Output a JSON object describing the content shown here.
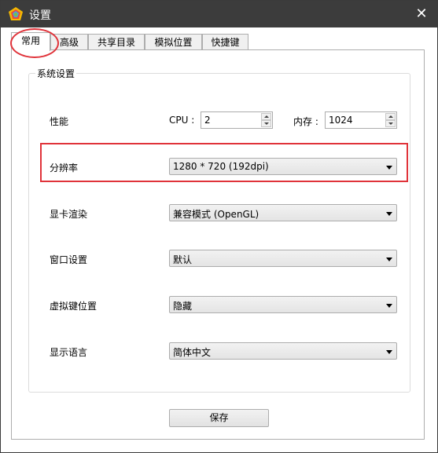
{
  "window": {
    "title": "设置",
    "close_icon": "✕"
  },
  "tabs": [
    {
      "label": "常用",
      "active": true
    },
    {
      "label": "高级",
      "active": false
    },
    {
      "label": "共享目录",
      "active": false
    },
    {
      "label": "模拟位置",
      "active": false
    },
    {
      "label": "快捷键",
      "active": false
    }
  ],
  "group": {
    "label": "系统设置"
  },
  "performance": {
    "label": "性能",
    "cpu_label": "CPU :",
    "cpu_value": "2",
    "memory_label": "内存 :",
    "memory_value": "1024"
  },
  "resolution": {
    "label": "分辨率",
    "value": "1280 * 720 (192dpi)"
  },
  "gpu_render": {
    "label": "显卡渲染",
    "value": "兼容模式 (OpenGL)"
  },
  "window_setting": {
    "label": "窗口设置",
    "value": "默认"
  },
  "virtual_key": {
    "label": "虚拟键位置",
    "value": "隐藏"
  },
  "language": {
    "label": "显示语言",
    "value": "简体中文"
  },
  "actions": {
    "save_label": "保存"
  },
  "colors": {
    "titlebar": "#3c3c3c",
    "annotation": "#e0333a"
  }
}
